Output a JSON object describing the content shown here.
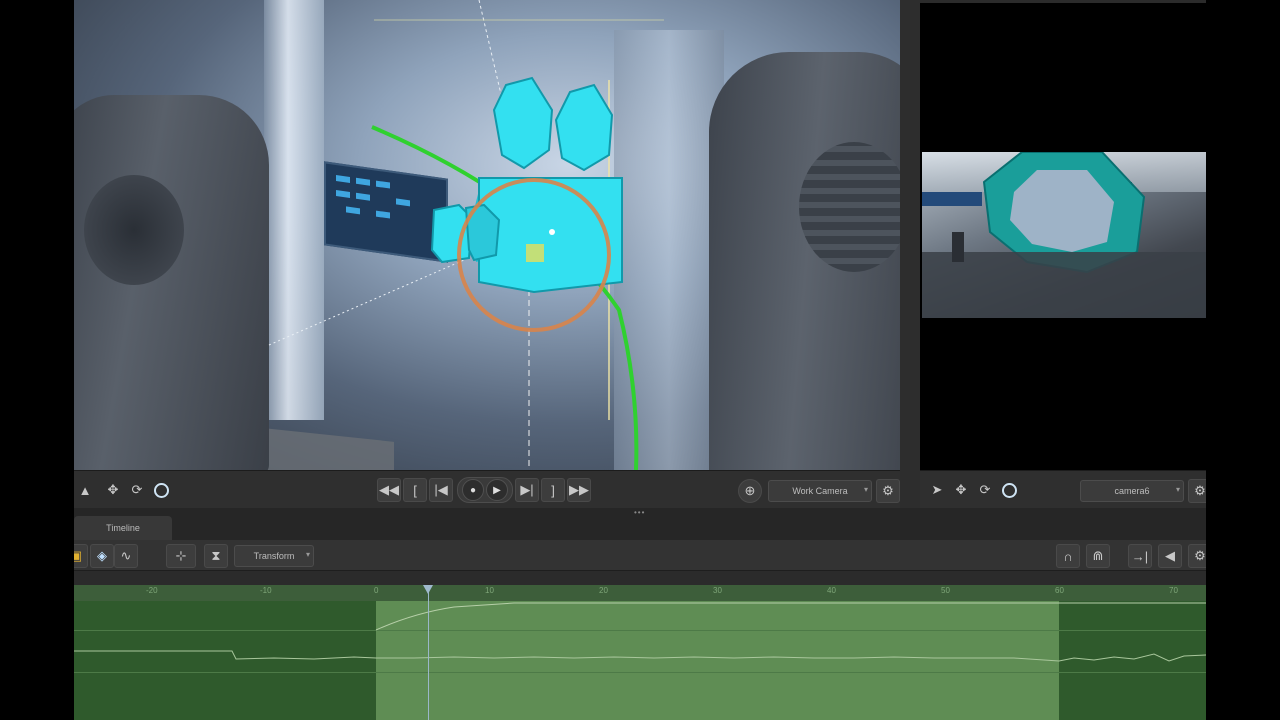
{
  "viewport": {
    "camera_select": "Work Camera"
  },
  "preview": {
    "camera_select": "camera6"
  },
  "timeline": {
    "tab_label": "Timeline",
    "mode_select": "Transform",
    "ruler_ticks": [
      "-20",
      "-10",
      "0",
      "10",
      "20",
      "30",
      "40",
      "50",
      "60",
      "70"
    ]
  },
  "colors": {
    "camera_gizmo": "#33e0f0",
    "motion_path": "#2fd12f",
    "rotation_ring": "#d8844a",
    "track_active": "#5f8d54",
    "track_inactive": "#2f5a2c"
  },
  "icons": {
    "select": "arrow-icon",
    "move": "move-icon",
    "rotate": "rotate-icon",
    "orbit": "orbit-icon",
    "settings": "gear-icon",
    "magnet": "magnet-icon",
    "audio": "speaker-icon"
  }
}
